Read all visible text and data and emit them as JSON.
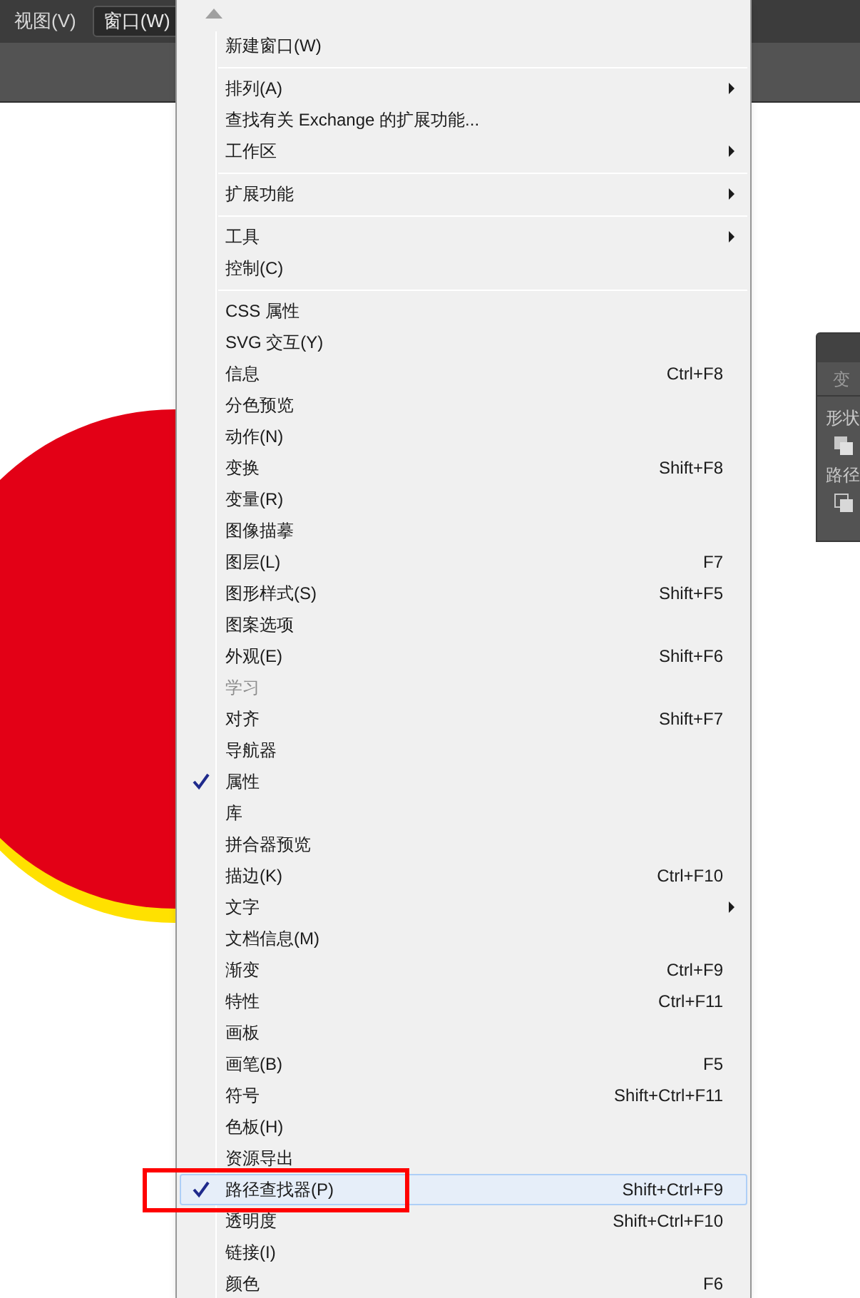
{
  "menubar": [
    {
      "label": "视图(V)",
      "selected": false
    },
    {
      "label": "窗口(W)",
      "selected": true
    }
  ],
  "side_panel": {
    "tab": "变",
    "sections": [
      "形状",
      "路径"
    ]
  },
  "menu": {
    "items": [
      {
        "kind": "item",
        "label": "新建窗口(W)"
      },
      {
        "kind": "separator"
      },
      {
        "kind": "item",
        "label": "排列(A)",
        "submenu": true
      },
      {
        "kind": "item",
        "label": "查找有关 Exchange 的扩展功能..."
      },
      {
        "kind": "item",
        "label": "工作区",
        "submenu": true
      },
      {
        "kind": "separator"
      },
      {
        "kind": "item",
        "label": "扩展功能",
        "submenu": true
      },
      {
        "kind": "separator"
      },
      {
        "kind": "item",
        "label": "工具",
        "submenu": true
      },
      {
        "kind": "item",
        "label": "控制(C)"
      },
      {
        "kind": "separator"
      },
      {
        "kind": "item",
        "label": "CSS 属性"
      },
      {
        "kind": "item",
        "label": "SVG 交互(Y)"
      },
      {
        "kind": "item",
        "label": "信息",
        "shortcut": "Ctrl+F8"
      },
      {
        "kind": "item",
        "label": "分色预览"
      },
      {
        "kind": "item",
        "label": "动作(N)"
      },
      {
        "kind": "item",
        "label": "变换",
        "shortcut": "Shift+F8"
      },
      {
        "kind": "item",
        "label": "变量(R)"
      },
      {
        "kind": "item",
        "label": "图像描摹"
      },
      {
        "kind": "item",
        "label": "图层(L)",
        "shortcut": "F7"
      },
      {
        "kind": "item",
        "label": "图形样式(S)",
        "shortcut": "Shift+F5"
      },
      {
        "kind": "item",
        "label": "图案选项"
      },
      {
        "kind": "item",
        "label": "外观(E)",
        "shortcut": "Shift+F6"
      },
      {
        "kind": "item",
        "label": "学习",
        "disabled": true
      },
      {
        "kind": "item",
        "label": "对齐",
        "shortcut": "Shift+F7"
      },
      {
        "kind": "item",
        "label": "导航器"
      },
      {
        "kind": "item",
        "label": "属性",
        "checked": true
      },
      {
        "kind": "item",
        "label": "库"
      },
      {
        "kind": "item",
        "label": "拼合器预览"
      },
      {
        "kind": "item",
        "label": "描边(K)",
        "shortcut": "Ctrl+F10"
      },
      {
        "kind": "item",
        "label": "文字",
        "submenu": true
      },
      {
        "kind": "item",
        "label": "文档信息(M)"
      },
      {
        "kind": "item",
        "label": "渐变",
        "shortcut": "Ctrl+F9"
      },
      {
        "kind": "item",
        "label": "特性",
        "shortcut": "Ctrl+F11"
      },
      {
        "kind": "item",
        "label": "画板"
      },
      {
        "kind": "item",
        "label": "画笔(B)",
        "shortcut": "F5"
      },
      {
        "kind": "item",
        "label": "符号",
        "shortcut": "Shift+Ctrl+F11"
      },
      {
        "kind": "item",
        "label": "色板(H)"
      },
      {
        "kind": "item",
        "label": "资源导出"
      },
      {
        "kind": "item",
        "label": "路径查找器(P)",
        "shortcut": "Shift+Ctrl+F9",
        "checked": true,
        "selected": true
      },
      {
        "kind": "item",
        "label": "透明度",
        "shortcut": "Shift+Ctrl+F10"
      },
      {
        "kind": "item",
        "label": "链接(I)"
      },
      {
        "kind": "item",
        "label": "颜色",
        "shortcut": "F6"
      }
    ]
  }
}
